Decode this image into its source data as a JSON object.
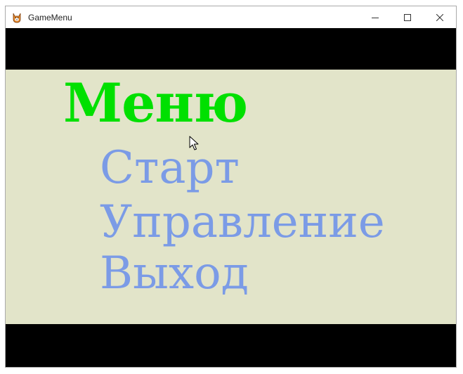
{
  "window": {
    "title": "GameMenu",
    "controls": {
      "minimize_icon": "minimize-icon",
      "maximize_icon": "maximize-icon",
      "close_icon": "close-icon"
    }
  },
  "menu": {
    "title": "Меню",
    "items": [
      {
        "label": "Старт"
      },
      {
        "label": "Управление"
      },
      {
        "label": "Выход"
      }
    ]
  },
  "colors": {
    "panel_background": "#e2e4c9",
    "title_color": "#00e000",
    "item_color": "#7b9be6",
    "letterbox": "#000000"
  }
}
